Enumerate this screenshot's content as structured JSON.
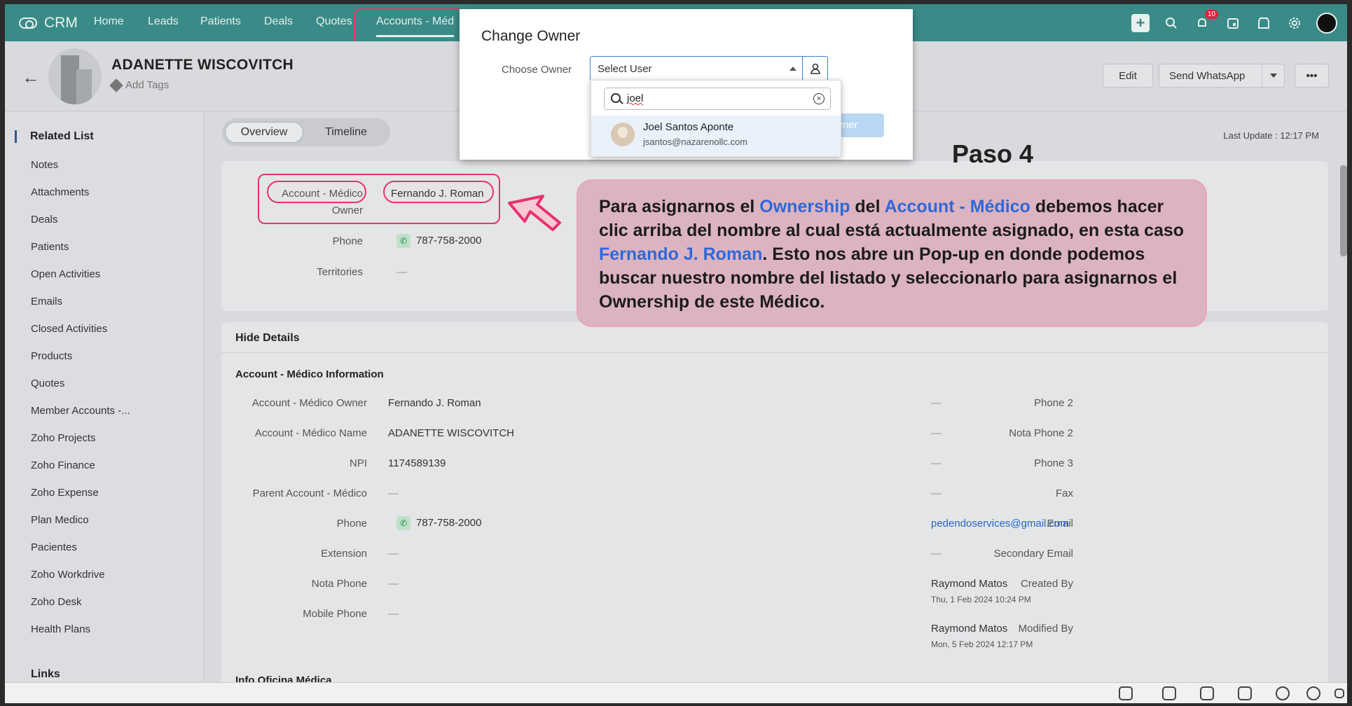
{
  "app": {
    "brand": "CRM"
  },
  "nav": {
    "tabs": [
      "Home",
      "Leads",
      "Patients",
      "Deals",
      "Quotes",
      "Accounts - Méd"
    ],
    "notification_count": "10"
  },
  "record": {
    "title": "ADANETTE WISCOVITCH",
    "add_tags": "Add Tags",
    "edit": "Edit",
    "send_whatsapp": "Send WhatsApp",
    "more": "•••"
  },
  "sidebar": {
    "title": "Related List",
    "items": [
      "Notes",
      "Attachments",
      "Deals",
      "Patients",
      "Open Activities",
      "Emails",
      "Closed Activities",
      "Products",
      "Quotes",
      "Member Accounts -...",
      "Zoho Projects",
      "Zoho Finance",
      "Zoho Expense",
      "Plan Medico",
      "Pacientes",
      "Zoho Workdrive",
      "Zoho Desk",
      "Health Plans"
    ],
    "links": "Links"
  },
  "tabs": {
    "overview": "Overview",
    "timeline": "Timeline"
  },
  "last_update": "Last Update : 12:17 PM",
  "summary": {
    "owner_label_1": "Account - Médico",
    "owner_label_2": "Owner",
    "owner_value": "Fernando J. Roman",
    "phone_label": "Phone",
    "phone_value": "787-758-2000",
    "territories_label": "Territories",
    "territories_value": "—"
  },
  "details": {
    "hide": "Hide Details",
    "section": "Account - Médico Information",
    "left": [
      {
        "label": "Account - Médico Owner",
        "value": "Fernando J. Roman"
      },
      {
        "label": "Account - Médico Name",
        "value": "ADANETTE WISCOVITCH"
      },
      {
        "label": "NPI",
        "value": "1174589139"
      },
      {
        "label": "Parent Account - Médico",
        "value": "—"
      },
      {
        "label": "Phone",
        "value": "787-758-2000"
      },
      {
        "label": "Extension",
        "value": "—"
      },
      {
        "label": "Nota Phone",
        "value": "—"
      },
      {
        "label": "Mobile Phone",
        "value": "—"
      }
    ],
    "right": [
      {
        "label": "Phone 2",
        "value": "—"
      },
      {
        "label": "Nota Phone 2",
        "value": "—"
      },
      {
        "label": "Phone 3",
        "value": "—"
      },
      {
        "label": "Fax",
        "value": "—"
      },
      {
        "label": "Email",
        "value": "pedendoservices@gmail.com"
      },
      {
        "label": "Secondary Email",
        "value": "—"
      },
      {
        "label": "Created By",
        "value": "Raymond Matos",
        "sub": "Thu, 1 Feb 2024 10:24 PM"
      },
      {
        "label": "Modified By",
        "value": "Raymond Matos",
        "sub": "Mon, 5 Feb 2024 12:17 PM"
      }
    ],
    "next_section": "Info Oficina Médica"
  },
  "modal": {
    "title": "Change Owner",
    "choose_label": "Choose Owner",
    "select_value": "Select User",
    "search_value": "joel",
    "result_name": "Joel Santos Aponte",
    "result_email": "jsantos@nazarenollc.com",
    "hidden_button": "wner"
  },
  "annotation": {
    "step": "Paso 4",
    "t1": "Para asignarnos el ",
    "t2": "Ownership",
    "t3": " del ",
    "t4": "Account - Médico",
    "t5": " debemos hacer clic arriba del nombre al cual está actualmente asignado, en esta caso ",
    "t6": "Fernando J. Roman",
    "t7": ". Esto nos abre un Pop-up en donde podemos buscar nuestro nombre del listado y seleccionarlo para asignarnos el Ownership de este Médico."
  },
  "colors": {
    "topbar": "#3a8b87",
    "highlight": "#e8326b",
    "link": "#2468c7"
  }
}
